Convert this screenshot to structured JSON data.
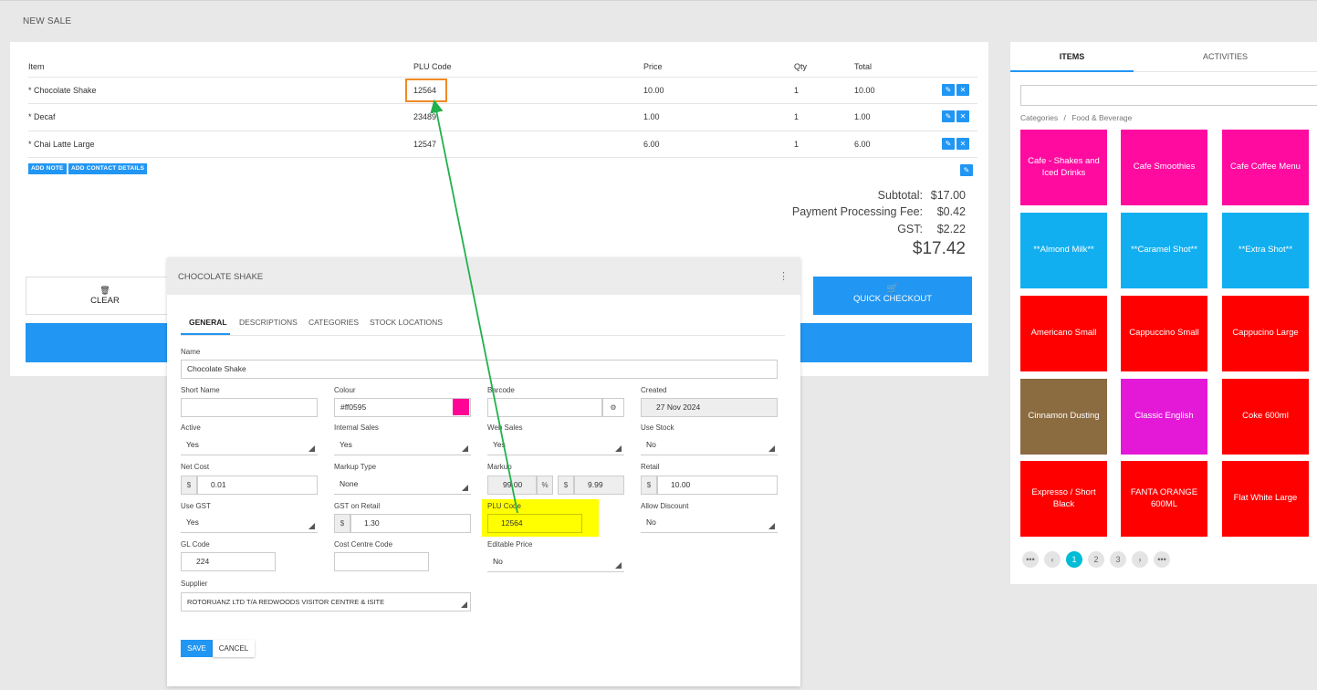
{
  "page": {
    "title": "NEW SALE"
  },
  "sale": {
    "headers": {
      "item": "Item",
      "plu": "PLU Code",
      "price": "Price",
      "qty": "Qty",
      "total": "Total"
    },
    "rows": [
      {
        "item": "* Chocolate Shake",
        "plu": "12564",
        "price": "10.00",
        "qty": "1",
        "total": "10.00"
      },
      {
        "item": "* Decaf",
        "plu": "23489",
        "price": "1.00",
        "qty": "1",
        "total": "1.00"
      },
      {
        "item": "* Chai Latte Large",
        "plu": "12547",
        "price": "6.00",
        "qty": "1",
        "total": "6.00"
      }
    ],
    "add_note": "ADD NOTE",
    "add_contact": "ADD CONTACT DETAILS",
    "summary": {
      "subtotal_label": "Subtotal:",
      "subtotal": "$17.00",
      "fee_label": "Payment Processing Fee:",
      "fee": "$0.42",
      "gst_label": "GST:",
      "gst": "$2.22",
      "total": "$17.42"
    },
    "clear_label": "CLEAR",
    "quick_checkout_label": "QUICK CHECKOUT"
  },
  "items_panel": {
    "tabs": [
      "ITEMS",
      "ACTIVITIES"
    ],
    "breadcrumb": {
      "root": "Categories",
      "sep": "/",
      "current": "Food & Beverage"
    },
    "tiles": [
      {
        "label": "Cafe - Shakes and Iced Drinks",
        "color": "#ff0ba0"
      },
      {
        "label": "Cafe Smoothies",
        "color": "#ff0ba0"
      },
      {
        "label": "Cafe Coffee Menu",
        "color": "#ff0ba0"
      },
      {
        "label": "**Almond Milk**",
        "color": "#12aff0"
      },
      {
        "label": "**Caramel Shot**",
        "color": "#12aff0"
      },
      {
        "label": "**Extra Shot**",
        "color": "#12aff0"
      },
      {
        "label": "Americano Small",
        "color": "#ff0000"
      },
      {
        "label": "Cappuccino Small",
        "color": "#ff0000"
      },
      {
        "label": "Cappucino Large",
        "color": "#ff0000"
      },
      {
        "label": "Cinnamon Dusting",
        "color": "#8b6b40"
      },
      {
        "label": "Classic English",
        "color": "#e419d8"
      },
      {
        "label": "Coke 600ml",
        "color": "#ff0000"
      },
      {
        "label": "Expresso / Short Black",
        "color": "#ff0000"
      },
      {
        "label": "FANTA ORANGE 600ML",
        "color": "#ff0000"
      },
      {
        "label": "Flat White Large",
        "color": "#ff0000"
      }
    ],
    "pagination": {
      "first": "•••",
      "prev": "‹",
      "pages": [
        "1",
        "2",
        "3"
      ],
      "current": "1",
      "next": "›",
      "last": "•••"
    }
  },
  "dialog": {
    "title": "CHOCOLATE SHAKE",
    "menu": "⋮",
    "tabs": [
      "GENERAL",
      "DESCRIPTIONS",
      "CATEGORIES",
      "STOCK LOCATIONS"
    ],
    "labels": {
      "name": "Name",
      "short_name": "Short Name",
      "colour": "Colour",
      "barcode": "Barcode",
      "created": "Created",
      "active": "Active",
      "internal_sales": "Internal Sales",
      "web_sales": "Web Sales",
      "use_stock": "Use Stock",
      "net_cost": "Net Cost",
      "markup_type": "Markup Type",
      "markup": "Markup",
      "retail": "Retail",
      "use_gst": "Use GST",
      "gst_on_retail": "GST on Retail",
      "plu_code": "PLU Code",
      "allow_discount": "Allow Discount",
      "gl_code": "GL Code",
      "cost_centre_code": "Cost Centre Code",
      "editable_price": "Editable Price",
      "supplier": "Supplier"
    },
    "values": {
      "name": "Chocolate Shake",
      "short_name": "",
      "colour": "#ff0595",
      "barcode": "",
      "created": "27 Nov 2024",
      "active": "Yes",
      "internal_sales": "Yes",
      "web_sales": "Yes",
      "use_stock": "No",
      "net_cost": "0.01",
      "markup_type": "None",
      "markup_pct": "99.00",
      "markup_amt": "9.99",
      "retail": "10.00",
      "use_gst": "Yes",
      "gst_on_retail": "1.30",
      "plu_code": "12564",
      "allow_discount": "No",
      "gl_code": "224",
      "cost_centre_code": "",
      "editable_price": "No",
      "supplier": "ROTORUANZ LTD T/A REDWOODS VISITOR CENTRE & ISITE"
    },
    "currency": "$",
    "percent": "%",
    "save_label": "SAVE",
    "cancel_label": "CANCEL"
  },
  "colors": {
    "primary": "#2196f3",
    "highlight_yellow": "#ffff00",
    "highlight_orange": "#f08a24",
    "arrow_green": "#22b14c"
  }
}
